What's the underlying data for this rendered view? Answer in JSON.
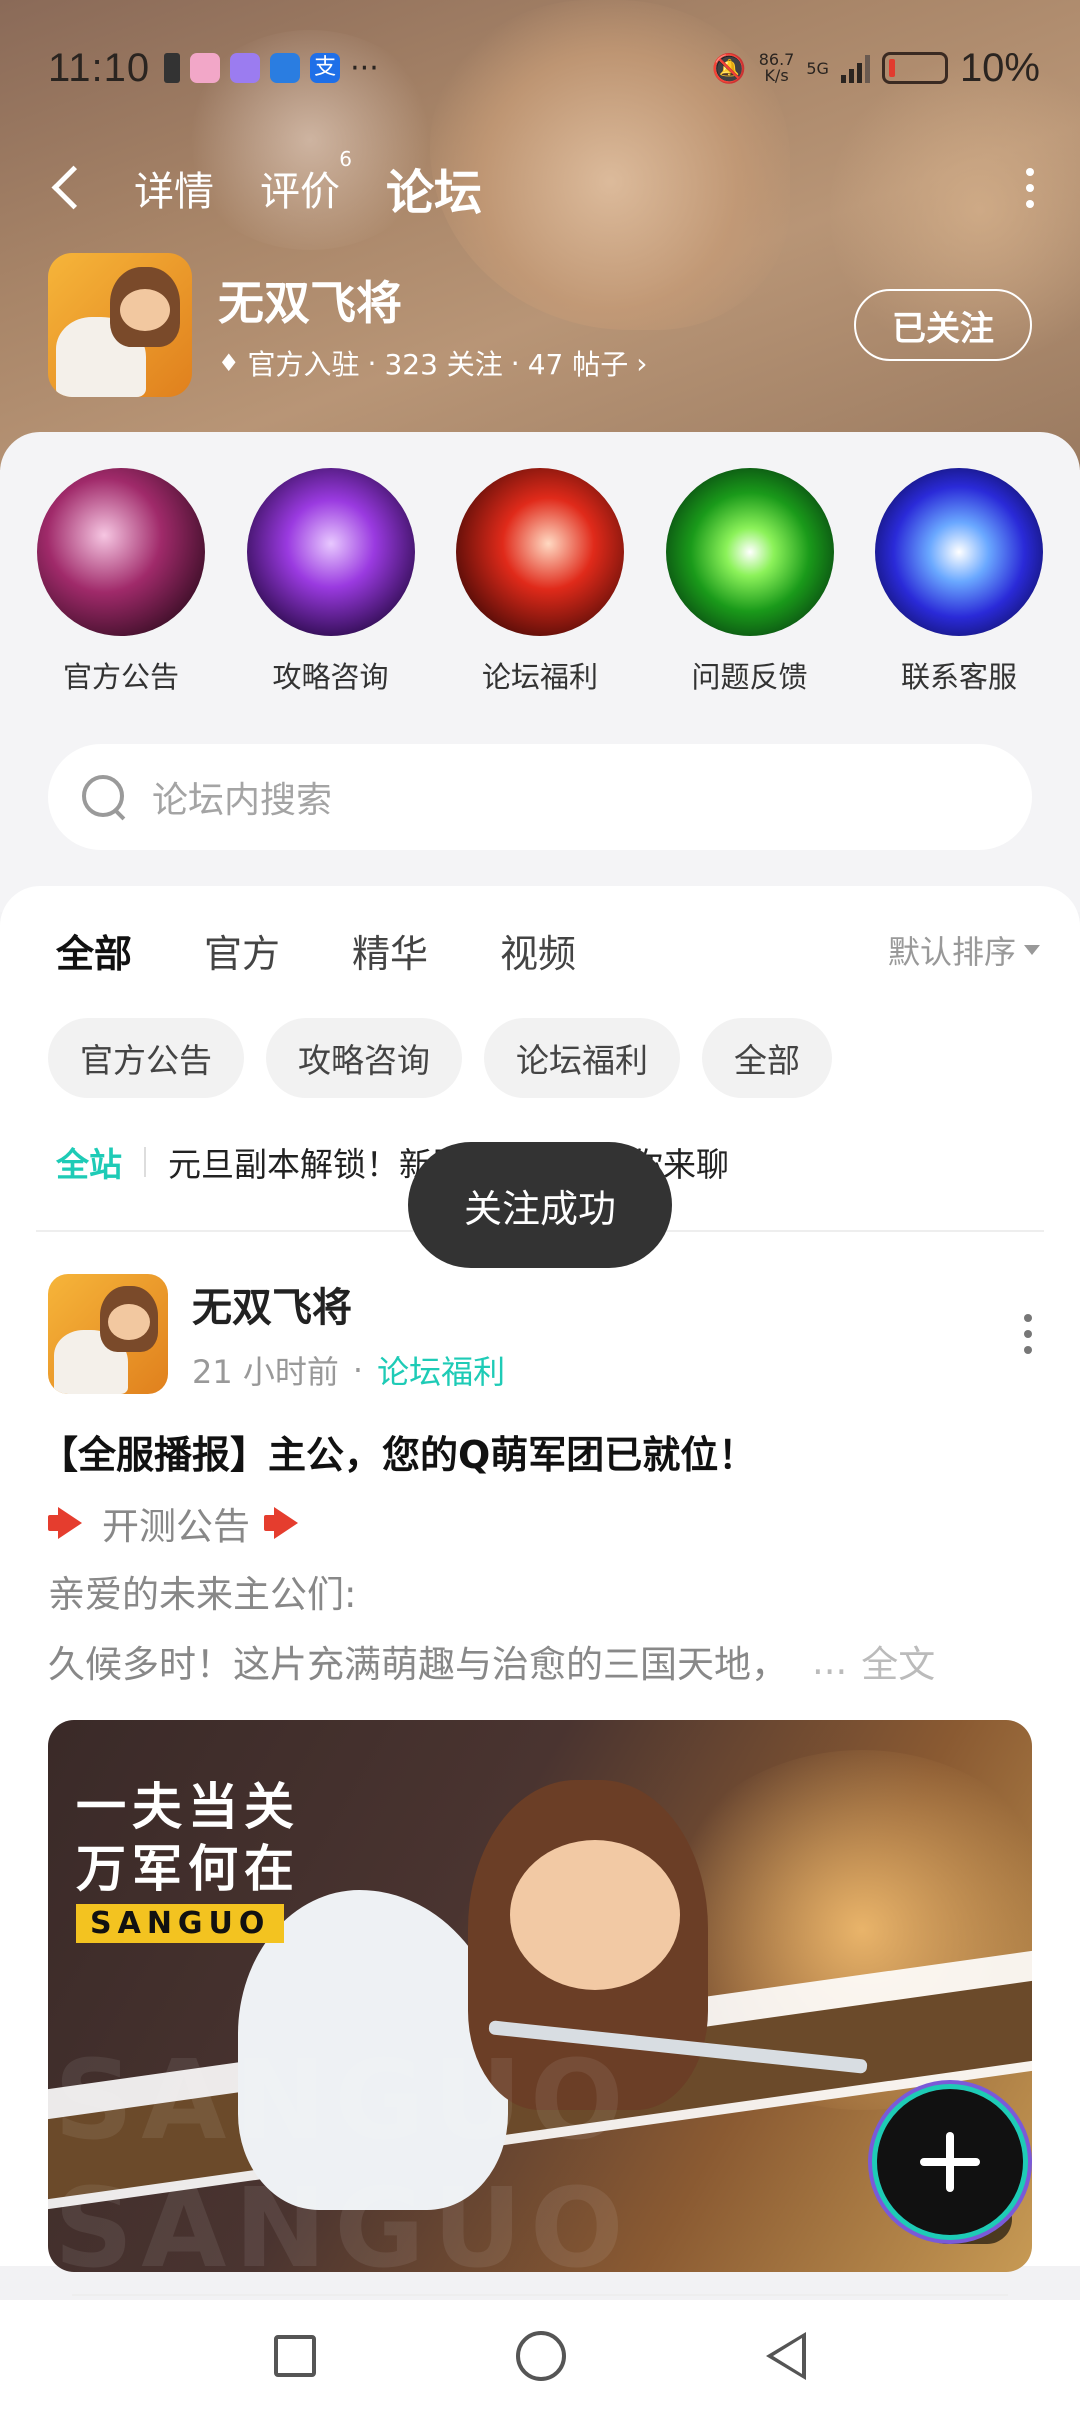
{
  "status_bar": {
    "time": "11:10",
    "speed_top": "86.7",
    "speed_unit": "K/s",
    "network": "5G",
    "battery": "10%",
    "app_icon_colors": [
      "#f2a7c8",
      "#9b7cf0",
      "#2a7de1",
      "#1e6fe8"
    ]
  },
  "nav": {
    "tabs": [
      {
        "label": "详情"
      },
      {
        "label": "评价",
        "badge": "6"
      },
      {
        "label": "论坛"
      }
    ],
    "active_tab": "论坛"
  },
  "game": {
    "name": "无双飞将",
    "official": "官方入驻",
    "followers": "323 关注",
    "posts": "47 帖子",
    "follow_button": "已关注"
  },
  "categories": [
    {
      "label": "官方公告",
      "icon": "announcement-icon"
    },
    {
      "label": "攻略咨询",
      "icon": "guide-icon"
    },
    {
      "label": "论坛福利",
      "icon": "welfare-icon"
    },
    {
      "label": "问题反馈",
      "icon": "feedback-icon"
    },
    {
      "label": "联系客服",
      "icon": "customer-service-icon"
    }
  ],
  "search": {
    "placeholder": "论坛内搜索"
  },
  "feed_tabs": [
    "全部",
    "官方",
    "精华",
    "视频"
  ],
  "feed_active_tab": "全部",
  "sort_label": "默认排序",
  "chips": [
    "官方公告",
    "攻略咨询",
    "论坛福利",
    "全部"
  ],
  "ticker": {
    "tag": "全站",
    "message": "元旦副本解锁！新题讨论活动等你来聊"
  },
  "toast": "关注成功",
  "post": {
    "author": "无双飞将",
    "time": "21 小时前",
    "forum": "论坛福利",
    "title": "【全服播报】主公，您的Q萌军团已就位！",
    "line1": "开测公告",
    "line2": "亲爱的未来主公们:",
    "line3": "久候多时！这片充满萌趣与治愈的三国天地，",
    "ellipsis": "...",
    "full_text": "全文",
    "banner_slogan_1": "一夫当关",
    "banner_slogan_2": "万军何在",
    "banner_tag": "SANGUO",
    "banner_bg_text": "SANGUO SANGUO",
    "image_count": "2"
  },
  "colors": {
    "accent": "#1ecbb6",
    "toast_bg": "#333333"
  }
}
